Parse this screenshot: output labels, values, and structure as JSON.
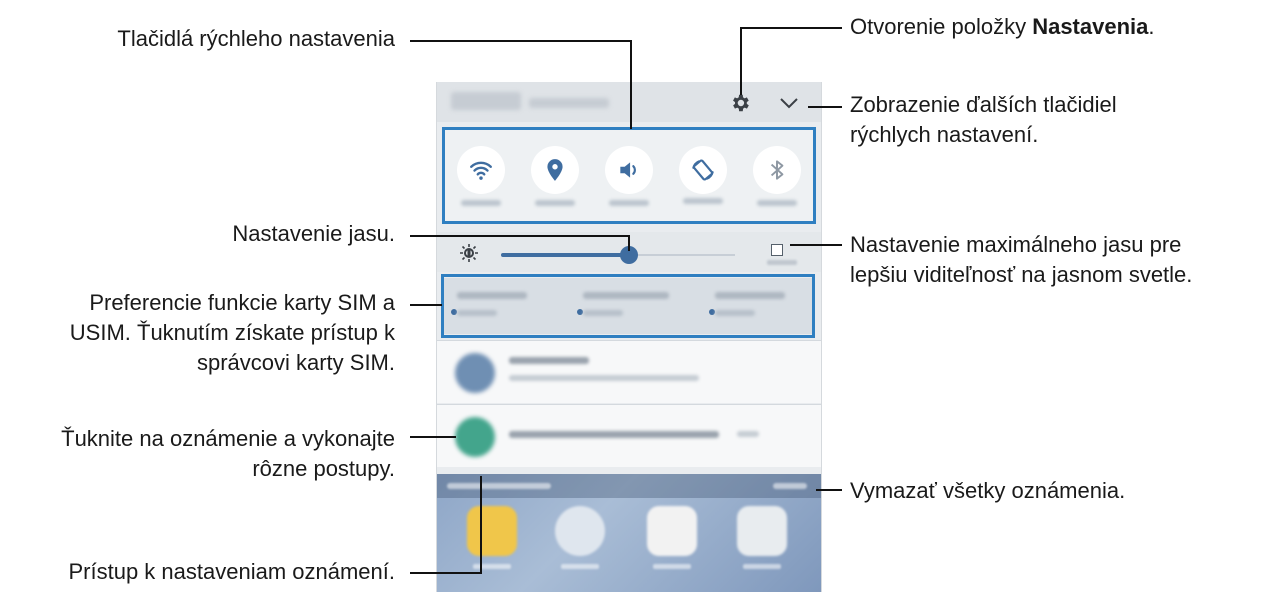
{
  "callouts": {
    "quick_buttons": "Tlačidlá rýchleho nastavenia",
    "open_settings_prefix": "Otvorenie položky ",
    "open_settings_bold": "Nastavenia",
    "open_settings_suffix": ".",
    "more_buttons_line1": "Zobrazenie ďalších tlačidiel",
    "more_buttons_line2": "rýchlych nastavení.",
    "brightness": "Nastavenie jasu.",
    "max_brightness_line1": "Nastavenie maximálneho jasu pre",
    "max_brightness_line2": "lepšiu viditeľnosť na jasnom svetle.",
    "sim_line1": "Preferencie funkcie karty SIM a",
    "sim_line2": "USIM. Ťuknutím získate prístup k",
    "sim_line3": "správcovi karty SIM.",
    "notification_line1": "Ťuknite na oznámenie a vykonajte",
    "notification_line2": "rôzne postupy.",
    "clear_all": "Vymazať všetky oznámenia.",
    "notification_settings": "Prístup k nastaveniam oznámení."
  },
  "panel": {
    "quick_buttons": [
      "wifi-icon",
      "location-icon",
      "sound-icon",
      "rotation-icon",
      "bluetooth-icon"
    ],
    "accent_color": "#2f7fc1",
    "slider_color": "#3f6da0"
  }
}
